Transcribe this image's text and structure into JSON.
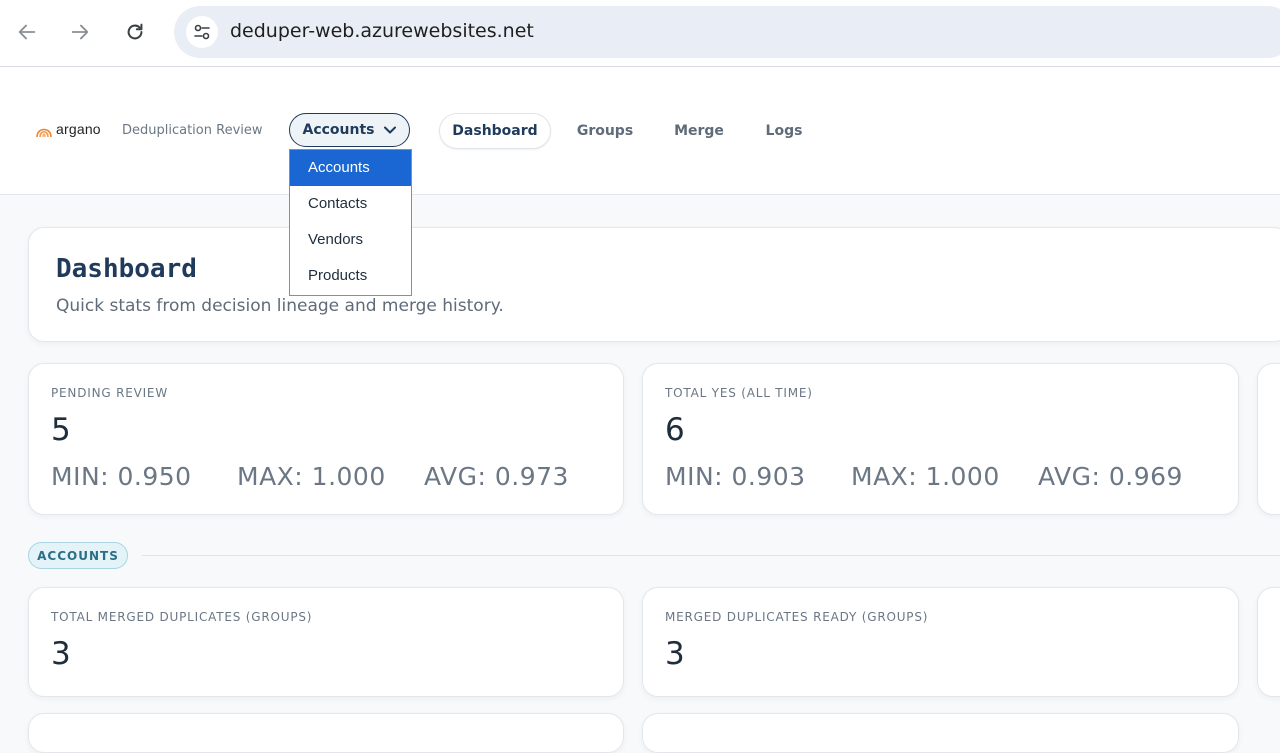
{
  "browser": {
    "url": "deduper-web.azurewebsites.net"
  },
  "header": {
    "logo_text": "argano",
    "subtitle": "Deduplication Review",
    "entity_selected": "Accounts",
    "tabs": [
      {
        "label": "Dashboard",
        "active": true
      },
      {
        "label": "Groups",
        "active": false
      },
      {
        "label": "Merge",
        "active": false
      },
      {
        "label": "Logs",
        "active": false
      }
    ]
  },
  "dropdown": {
    "options": [
      "Accounts",
      "Contacts",
      "Vendors",
      "Products"
    ],
    "selected": "Accounts"
  },
  "dashboard": {
    "title": "Dashboard",
    "subtitle": "Quick stats from decision lineage and merge history."
  },
  "stats": {
    "pending": {
      "label": "PENDING REVIEW",
      "value": "5",
      "min": "MIN: 0.950",
      "max": "MAX: 1.000",
      "avg": "AVG: 0.973"
    },
    "total_yes": {
      "label": "TOTAL YES (ALL TIME)",
      "value": "6",
      "min": "MIN: 0.903",
      "max": "MAX: 1.000",
      "avg": "AVG: 0.969"
    }
  },
  "section": {
    "label": "ACCOUNTS"
  },
  "accounts": {
    "merged": {
      "label": "TOTAL MERGED DUPLICATES (GROUPS)",
      "value": "3"
    },
    "ready": {
      "label": "MERGED DUPLICATES READY (GROUPS)",
      "value": "3"
    }
  },
  "colors": {
    "accent": "#1f3a5a",
    "selection": "#1a66d2",
    "chip": "#2a6f86"
  }
}
